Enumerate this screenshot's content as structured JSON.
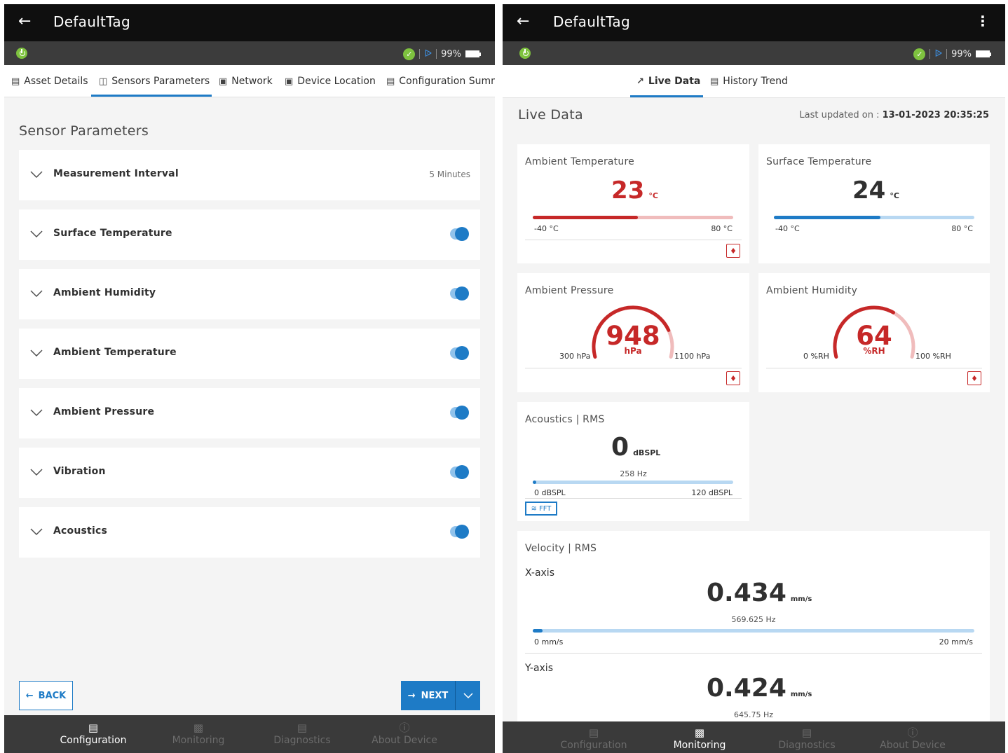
{
  "left": {
    "appbar": {
      "title": "DefaultTag"
    },
    "status": {
      "battery": "99%"
    },
    "tabs": [
      {
        "label": "Asset Details",
        "icon": "document-icon"
      },
      {
        "label": "Sensors Parameters",
        "icon": "sensor-icon"
      },
      {
        "label": "Network",
        "icon": "network-icon"
      },
      {
        "label": "Device Location",
        "icon": "location-icon"
      },
      {
        "label": "Configuration Summ",
        "icon": "summary-icon"
      }
    ],
    "section_title": "Sensor Parameters",
    "params": [
      {
        "label": "Measurement Interval",
        "value": "5 Minutes",
        "toggle": false
      },
      {
        "label": "Surface Temperature",
        "toggle": true
      },
      {
        "label": "Ambient Humidity",
        "toggle": true
      },
      {
        "label": "Ambient Temperature",
        "toggle": true
      },
      {
        "label": "Ambient Pressure",
        "toggle": true
      },
      {
        "label": "Vibration",
        "toggle": true
      },
      {
        "label": "Acoustics",
        "toggle": true
      }
    ],
    "buttons": {
      "back": "BACK",
      "next": "NEXT"
    },
    "nav": [
      {
        "label": "Configuration",
        "active": true
      },
      {
        "label": "Monitoring",
        "active": false
      },
      {
        "label": "Diagnostics",
        "active": false
      },
      {
        "label": "About Device",
        "active": false
      }
    ]
  },
  "right": {
    "appbar": {
      "title": "DefaultTag"
    },
    "status": {
      "battery": "99%"
    },
    "tabs": [
      {
        "label": "Live Data",
        "icon": "trend-icon"
      },
      {
        "label": "History Trend",
        "icon": "history-icon"
      }
    ],
    "section_title": "Live Data",
    "last_updated_label": "Last updated on :",
    "last_updated_value": "13-01-2023 20:35:25",
    "ambient_temp": {
      "title": "Ambient Temperature",
      "value": "23",
      "unit": "°C",
      "min": "-40 °C",
      "max": "80 °C",
      "level": 0.525,
      "color": "#c62828"
    },
    "surface_temp": {
      "title": "Surface Temperature",
      "value": "24",
      "unit": "°C",
      "min": "-40 °C",
      "max": "80 °C",
      "level": 0.53,
      "color": "#1e7bc6"
    },
    "ambient_pressure": {
      "title": "Ambient Pressure",
      "value": "948",
      "unit": "hPa",
      "min": "300 hPa",
      "max": "1100 hPa",
      "level": 0.81
    },
    "ambient_humidity": {
      "title": "Ambient Humidity",
      "value": "64",
      "unit": "%RH",
      "min": "0 %RH",
      "max": "100 %RH",
      "level": 0.64
    },
    "acoustics": {
      "title": "Acoustics | RMS",
      "value": "0",
      "unit": "dBSPL",
      "freq": "258 Hz",
      "min": "0 dBSPL",
      "max": "120 dBSPL",
      "level": 0.0,
      "fft": "FFT"
    },
    "velocity": {
      "title": "Velocity | RMS",
      "x_label": "X-axis",
      "x_value": "0.434",
      "unit": "mm/s",
      "x_freq": "569.625 Hz",
      "x_min": "0 mm/s",
      "x_max": "20 mm/s",
      "x_level": 0.022,
      "y_label": "Y-axis",
      "y_value": "0.424",
      "y_freq": "645.75 Hz"
    },
    "nav": [
      {
        "label": "Configuration",
        "active": false
      },
      {
        "label": "Monitoring",
        "active": true
      },
      {
        "label": "Diagnostics",
        "active": false
      },
      {
        "label": "About Device",
        "active": false
      }
    ]
  }
}
